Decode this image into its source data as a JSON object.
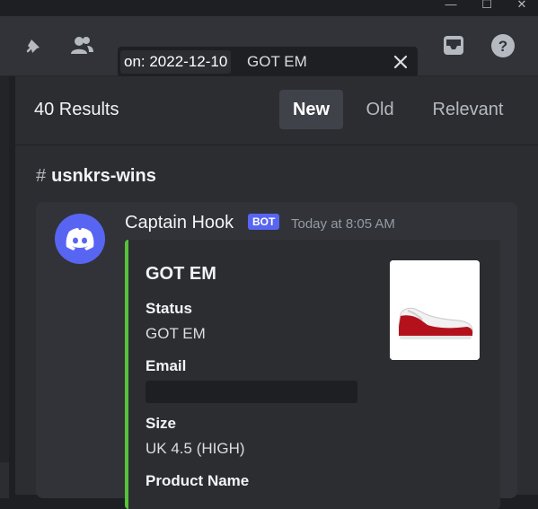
{
  "window": {
    "buttons": [
      {
        "name": "minimize",
        "glyph": "—"
      },
      {
        "name": "maximize",
        "glyph": "☐"
      },
      {
        "name": "close",
        "glyph": "✕"
      }
    ]
  },
  "toolbar": {
    "icons": [
      "pin-icon",
      "members-icon",
      "inbox-icon",
      "help-icon"
    ]
  },
  "search": {
    "filter_chip": "on: 2022-12-10",
    "query": "GOT EM"
  },
  "results": {
    "count_label": "40 Results",
    "tabs": [
      {
        "label": "New",
        "active": true
      },
      {
        "label": "Old",
        "active": false
      },
      {
        "label": "Relevant",
        "active": false
      }
    ]
  },
  "channel": {
    "hash": "#",
    "name": "usnkrs-wins"
  },
  "message": {
    "author": "Captain Hook",
    "bot_tag": "BOT",
    "timestamp": "Today at 8:05 AM",
    "embed": {
      "accent_color": "#57c23a",
      "title": "GOT EM",
      "fields": [
        {
          "name": "Status",
          "value": "GOT EM"
        },
        {
          "name": "Email",
          "value": ""
        },
        {
          "name": "Size",
          "value": "UK 4.5 (HIGH)"
        },
        {
          "name": "Product Name",
          "value": ""
        }
      ]
    }
  },
  "colors": {
    "brand": "#5865f2",
    "background": "#313338",
    "panel": "#2b2d31"
  }
}
